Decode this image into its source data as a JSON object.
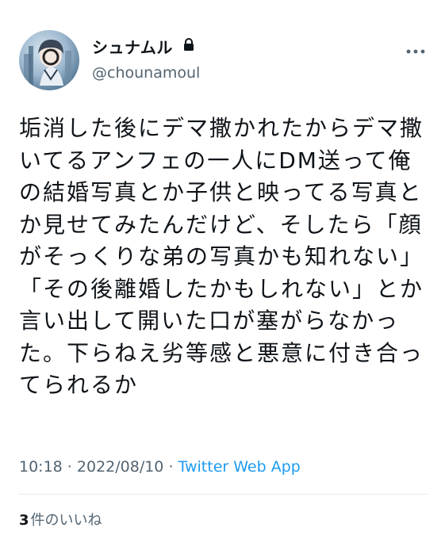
{
  "author": {
    "display_name": "シュナムル",
    "handle": "@chounamoul"
  },
  "tweet": {
    "text": "垢消した後にデマ撒かれたからデマ撒いてるアンフェの一人にDM送って俺の結婚写真とか子供と映ってる写真とか見せてみたんだけど、そしたら「顔がそっくりな弟の写真かも知れない」「その後離婚したかもしれない」とか言い出して開いた口が塞がらなかった。下らねえ劣等感と悪意に付き合ってられるか",
    "time": "10:18",
    "separator1": " · ",
    "date": "2022/08/10",
    "separator2": " · ",
    "app": "Twitter Web App"
  },
  "stats": {
    "likes_count": "3",
    "likes_label": "件のいいね"
  },
  "colors": {
    "link": "#1d9bf0",
    "secondary_text": "#536471",
    "primary_text": "#0f1419",
    "divider": "#e1e8ed"
  },
  "icons": {
    "lock": "lock-icon",
    "more": "more-options-icon"
  }
}
